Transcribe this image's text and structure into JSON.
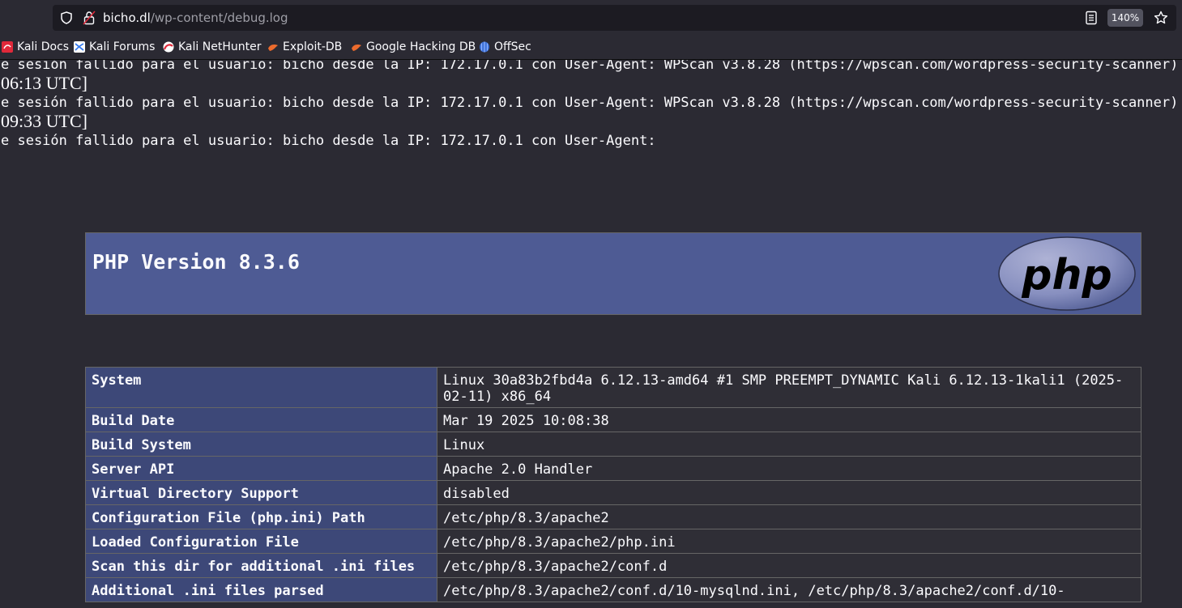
{
  "browser": {
    "url_domain": "bicho.dl",
    "url_path": "/wp-content/debug.log",
    "zoom": "140%"
  },
  "bookmarks": [
    {
      "label": "Kali Docs",
      "icon": "kali-docs-icon",
      "color": "#e0293a"
    },
    {
      "label": "Kali Forums",
      "icon": "kali-forums-icon",
      "color": "#367bf0"
    },
    {
      "label": "Kali NetHunter",
      "icon": "kali-nethunter-icon",
      "color": "#e0293a"
    },
    {
      "label": "Exploit-DB",
      "icon": "exploit-db-icon",
      "color": "#ec6b2d"
    },
    {
      "label": "Google Hacking DB",
      "icon": "google-hacking-db-icon",
      "color": "#ec6b2d"
    },
    {
      "label": "OffSec",
      "icon": "offsec-icon",
      "color": "#5b8def"
    }
  ],
  "log": {
    "line1": "e sesión fallido para el usuario: bicho desde la IP: 172.17.0.1 con User-Agent: WPScan v3.8.28 (https://wpscan.com/wordpress-security-scanner)",
    "time1": "06:13 UTC]",
    "line2": "e sesión fallido para el usuario: bicho desde la IP: 172.17.0.1 con User-Agent: WPScan v3.8.28 (https://wpscan.com/wordpress-security-scanner)",
    "time2": "09:33 UTC]",
    "line3": "e sesión fallido para el usuario: bicho desde la IP: 172.17.0.1 con User-Agent:"
  },
  "phpinfo": {
    "title": "PHP Version 8.3.6",
    "logo_text": "php",
    "rows": [
      {
        "key": "System",
        "value": "Linux 30a83b2fbd4a 6.12.13-amd64 #1 SMP PREEMPT_DYNAMIC Kali 6.12.13-1kali1 (2025-02-11) x86_64"
      },
      {
        "key": "Build Date",
        "value": "Mar 19 2025 10:08:38"
      },
      {
        "key": "Build System",
        "value": "Linux"
      },
      {
        "key": "Server API",
        "value": "Apache 2.0 Handler"
      },
      {
        "key": "Virtual Directory Support",
        "value": "disabled"
      },
      {
        "key": "Configuration File (php.ini) Path",
        "value": "/etc/php/8.3/apache2"
      },
      {
        "key": "Loaded Configuration File",
        "value": "/etc/php/8.3/apache2/php.ini"
      },
      {
        "key": "Scan this dir for additional .ini files",
        "value": "/etc/php/8.3/apache2/conf.d"
      },
      {
        "key": "Additional .ini files parsed",
        "value": "/etc/php/8.3/apache2/conf.d/10-mysqlnd.ini, /etc/php/8.3/apache2/conf.d/10-"
      }
    ]
  },
  "colors": {
    "chrome_bg": "#2b2a33",
    "php_header": "#4e5b94",
    "php_key_cell": "#3d4878"
  }
}
